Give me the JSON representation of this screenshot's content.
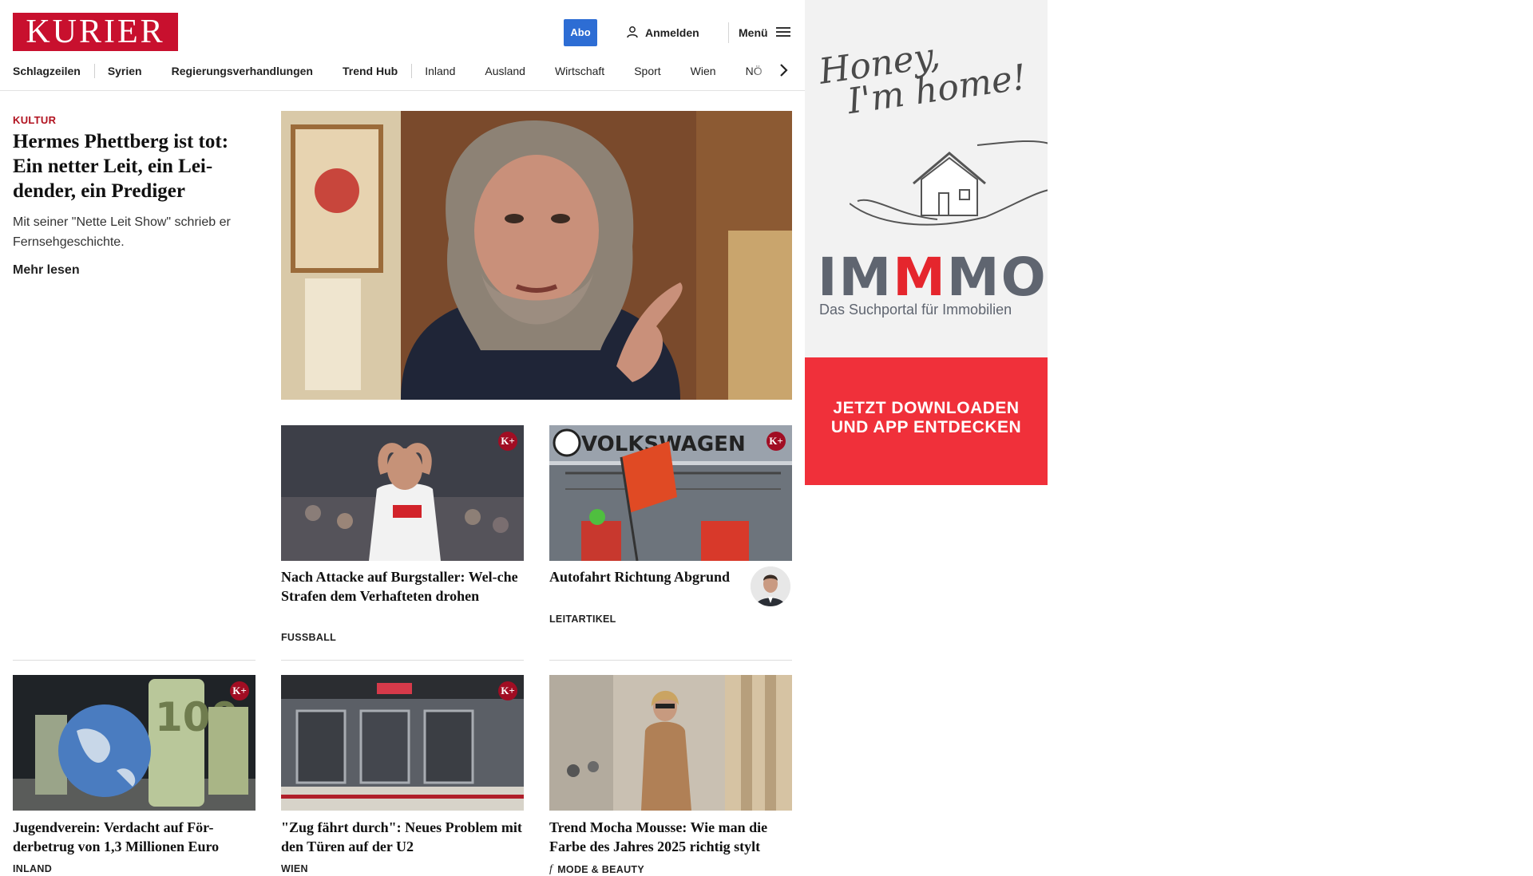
{
  "header": {
    "logo_text": "KURIER",
    "abo_label": "Abo",
    "login_label": "Anmelden",
    "menu_label": "Menü"
  },
  "nav": {
    "items": [
      "Schlagzeilen",
      "Syrien",
      "Regierungsverhandlungen",
      "Trend Hub",
      "Inland",
      "Ausland",
      "Wirtschaft",
      "Sport",
      "Wien",
      "NÖ"
    ]
  },
  "lead": {
    "kicker": "KULTUR",
    "title": "Hermes Phettberg ist tot: Ein netter Leit, ein Lei-dender, ein Prediger",
    "teaser": "Mit seiner \"Nette Leit Show\" schrieb er Fernsehgeschichte.",
    "more_label": "Mehr lesen"
  },
  "cards": [
    {
      "title": "Nach Attacke auf Burgstaller: Wel-che Strafen dem Verhafteten drohen",
      "category": "FUSSBALL",
      "plus": "K+"
    },
    {
      "title": "Autofahrt Richtung Abgrund",
      "category": "LEITARTIKEL",
      "plus": "K+",
      "image_sign": "VOLKSWAGEN"
    },
    {
      "title": "Jugendverein: Verdacht auf För-derbetrug von 1,3 Millionen Euro",
      "category": "INLAND",
      "plus": "K+"
    },
    {
      "title": "\"Zug fährt durch\": Neues Problem mit den Türen auf der U2",
      "category": "WIEN",
      "plus": "K+"
    },
    {
      "title": "Trend Mocha Mousse: Wie man die Farbe des Jahres 2025 richtig stylt",
      "category": "MODE & BEAUTY"
    }
  ],
  "ad": {
    "tagline_1": "Honey,",
    "tagline_2": "I'm home!",
    "brand_a": "IM",
    "brand_m": "M",
    "brand_b": "MO",
    "subtitle": "Das Suchportal für Immobilien",
    "cta_1": "JETZT DOWNLOADEN",
    "cta_2": "UND APP ENTDECKEN"
  },
  "colors": {
    "brand_red": "#c8102e",
    "kicker_red": "#b1121f",
    "abo_blue": "#2d6dd4",
    "ad_red": "#f0303a"
  },
  "icons": [
    "user-icon",
    "hamburger-icon",
    "chevron-right-icon",
    "k-plus-badge-icon",
    "fashion-f-icon"
  ]
}
